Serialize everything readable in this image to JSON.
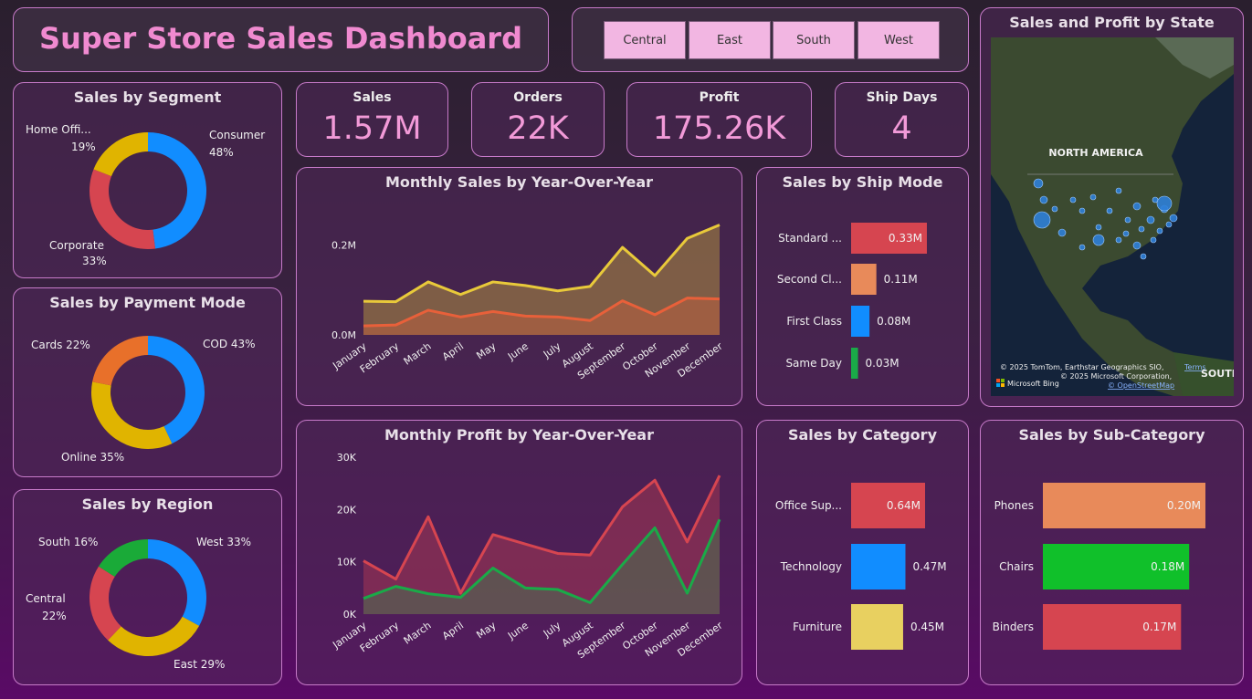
{
  "header": {
    "title": "Super Store Sales Dashboard"
  },
  "slicer": {
    "buttons": [
      "Central",
      "East",
      "South",
      "West"
    ]
  },
  "kpis": [
    {
      "label": "Sales",
      "value": "1.57M"
    },
    {
      "label": "Orders",
      "value": "22K"
    },
    {
      "label": "Profit",
      "value": "175.26K"
    },
    {
      "label": "Ship Days",
      "value": "4"
    }
  ],
  "map": {
    "title": "Sales and Profit by State",
    "region_label": "NORTH AMERICA",
    "region_label2": "SOUTH A",
    "attribution1": "© 2025 TomTom, Earthstar Geographics SIO,",
    "attribution_terms": "Terms",
    "attribution2": "© 2025 Microsoft Corporation,",
    "attribution3": "© OpenStreetMap",
    "brand": "Microsoft Bing",
    "colors": {
      "dot": "#2f7fd8",
      "land": "#3c4a2e",
      "water": "#14233a"
    }
  },
  "chart_data": [
    {
      "id": "segment",
      "type": "pie",
      "title": "Sales by Segment",
      "labels": [
        "Consumer",
        "Corporate",
        "Home Offi..."
      ],
      "values": [
        48,
        33,
        19
      ],
      "display": [
        "48%",
        "33%",
        "19%"
      ],
      "colors": [
        "#118dff",
        "#d64550",
        "#e0b400"
      ]
    },
    {
      "id": "payment",
      "type": "pie",
      "title": "Sales by Payment Mode",
      "labels": [
        "COD 43%",
        "Online 35%",
        "Cards 22%"
      ],
      "values": [
        43,
        35,
        22
      ],
      "colors": [
        "#118dff",
        "#e0b400",
        "#e8702a"
      ]
    },
    {
      "id": "region",
      "type": "pie",
      "title": "Sales by Region",
      "labels": [
        "West 33%",
        "East 29%",
        "Central",
        "South 16%"
      ],
      "central_pct": "22%",
      "values": [
        33,
        29,
        22,
        16
      ],
      "colors": [
        "#118dff",
        "#e0b400",
        "#d64550",
        "#1aaa38"
      ]
    },
    {
      "id": "monthly_sales",
      "type": "area",
      "title": "Monthly Sales by Year-Over-Year",
      "categories": [
        "January",
        "February",
        "March",
        "April",
        "May",
        "June",
        "July",
        "August",
        "September",
        "October",
        "November",
        "December"
      ],
      "yticks": [
        "0.0M",
        "0.2M"
      ],
      "ytick_values": [
        0,
        0.2
      ],
      "ylim": [
        0,
        0.25
      ],
      "series": [
        {
          "values": [
            0.075,
            0.074,
            0.118,
            0.09,
            0.118,
            0.11,
            0.098,
            0.108,
            0.195,
            0.132,
            0.215,
            0.245
          ],
          "color": "#e8c93a"
        },
        {
          "values": [
            0.02,
            0.022,
            0.055,
            0.04,
            0.052,
            0.042,
            0.04,
            0.032,
            0.076,
            0.045,
            0.082,
            0.08
          ],
          "color": "#e8603a"
        }
      ]
    },
    {
      "id": "monthly_profit",
      "type": "area",
      "title": "Monthly Profit by Year-Over-Year",
      "categories": [
        "January",
        "February",
        "March",
        "April",
        "May",
        "June",
        "July",
        "August",
        "September",
        "October",
        "November",
        "December"
      ],
      "yticks": [
        "0K",
        "10K",
        "20K",
        "30K"
      ],
      "ytick_values": [
        0,
        10000,
        20000,
        30000
      ],
      "ylim": [
        0,
        30000
      ],
      "series": [
        {
          "values": [
            10200,
            6700,
            18600,
            4000,
            15200,
            13400,
            11600,
            11300,
            20500,
            25600,
            13800,
            26500
          ],
          "color": "#d64550"
        },
        {
          "values": [
            3000,
            5300,
            3900,
            3200,
            8800,
            5000,
            4700,
            2200,
            9500,
            16500,
            4000,
            18100
          ],
          "color": "#1aaa48"
        }
      ]
    },
    {
      "id": "ship_mode",
      "type": "bar",
      "title": "Sales by Ship Mode",
      "categories": [
        "Standard ...",
        "Second Cl...",
        "First Class",
        "Same Day"
      ],
      "values": [
        0.33,
        0.11,
        0.08,
        0.03
      ],
      "display": [
        "0.33M",
        "0.11M",
        "0.08M",
        "0.03M"
      ],
      "colors": [
        "#d64550",
        "#e88a5a",
        "#118dff",
        "#1aaa48"
      ],
      "xlim": [
        0,
        0.35
      ]
    },
    {
      "id": "category",
      "type": "bar",
      "title": "Sales by Category",
      "categories": [
        "Office Sup...",
        "Technology",
        "Furniture"
      ],
      "values": [
        0.64,
        0.47,
        0.45
      ],
      "display": [
        "0.64M",
        "0.47M",
        "0.45M"
      ],
      "colors": [
        "#d64550",
        "#118dff",
        "#e8d060"
      ],
      "xlim": [
        0,
        0.64
      ]
    },
    {
      "id": "subcategory",
      "type": "bar",
      "title": "Sales by Sub-Category",
      "categories": [
        "Phones",
        "Chairs",
        "Binders"
      ],
      "values": [
        0.2,
        0.18,
        0.17
      ],
      "display": [
        "0.20M",
        "0.18M",
        "0.17M"
      ],
      "colors": [
        "#e88a5a",
        "#10c02a",
        "#d64550"
      ],
      "xlim": [
        0,
        0.2
      ]
    }
  ]
}
